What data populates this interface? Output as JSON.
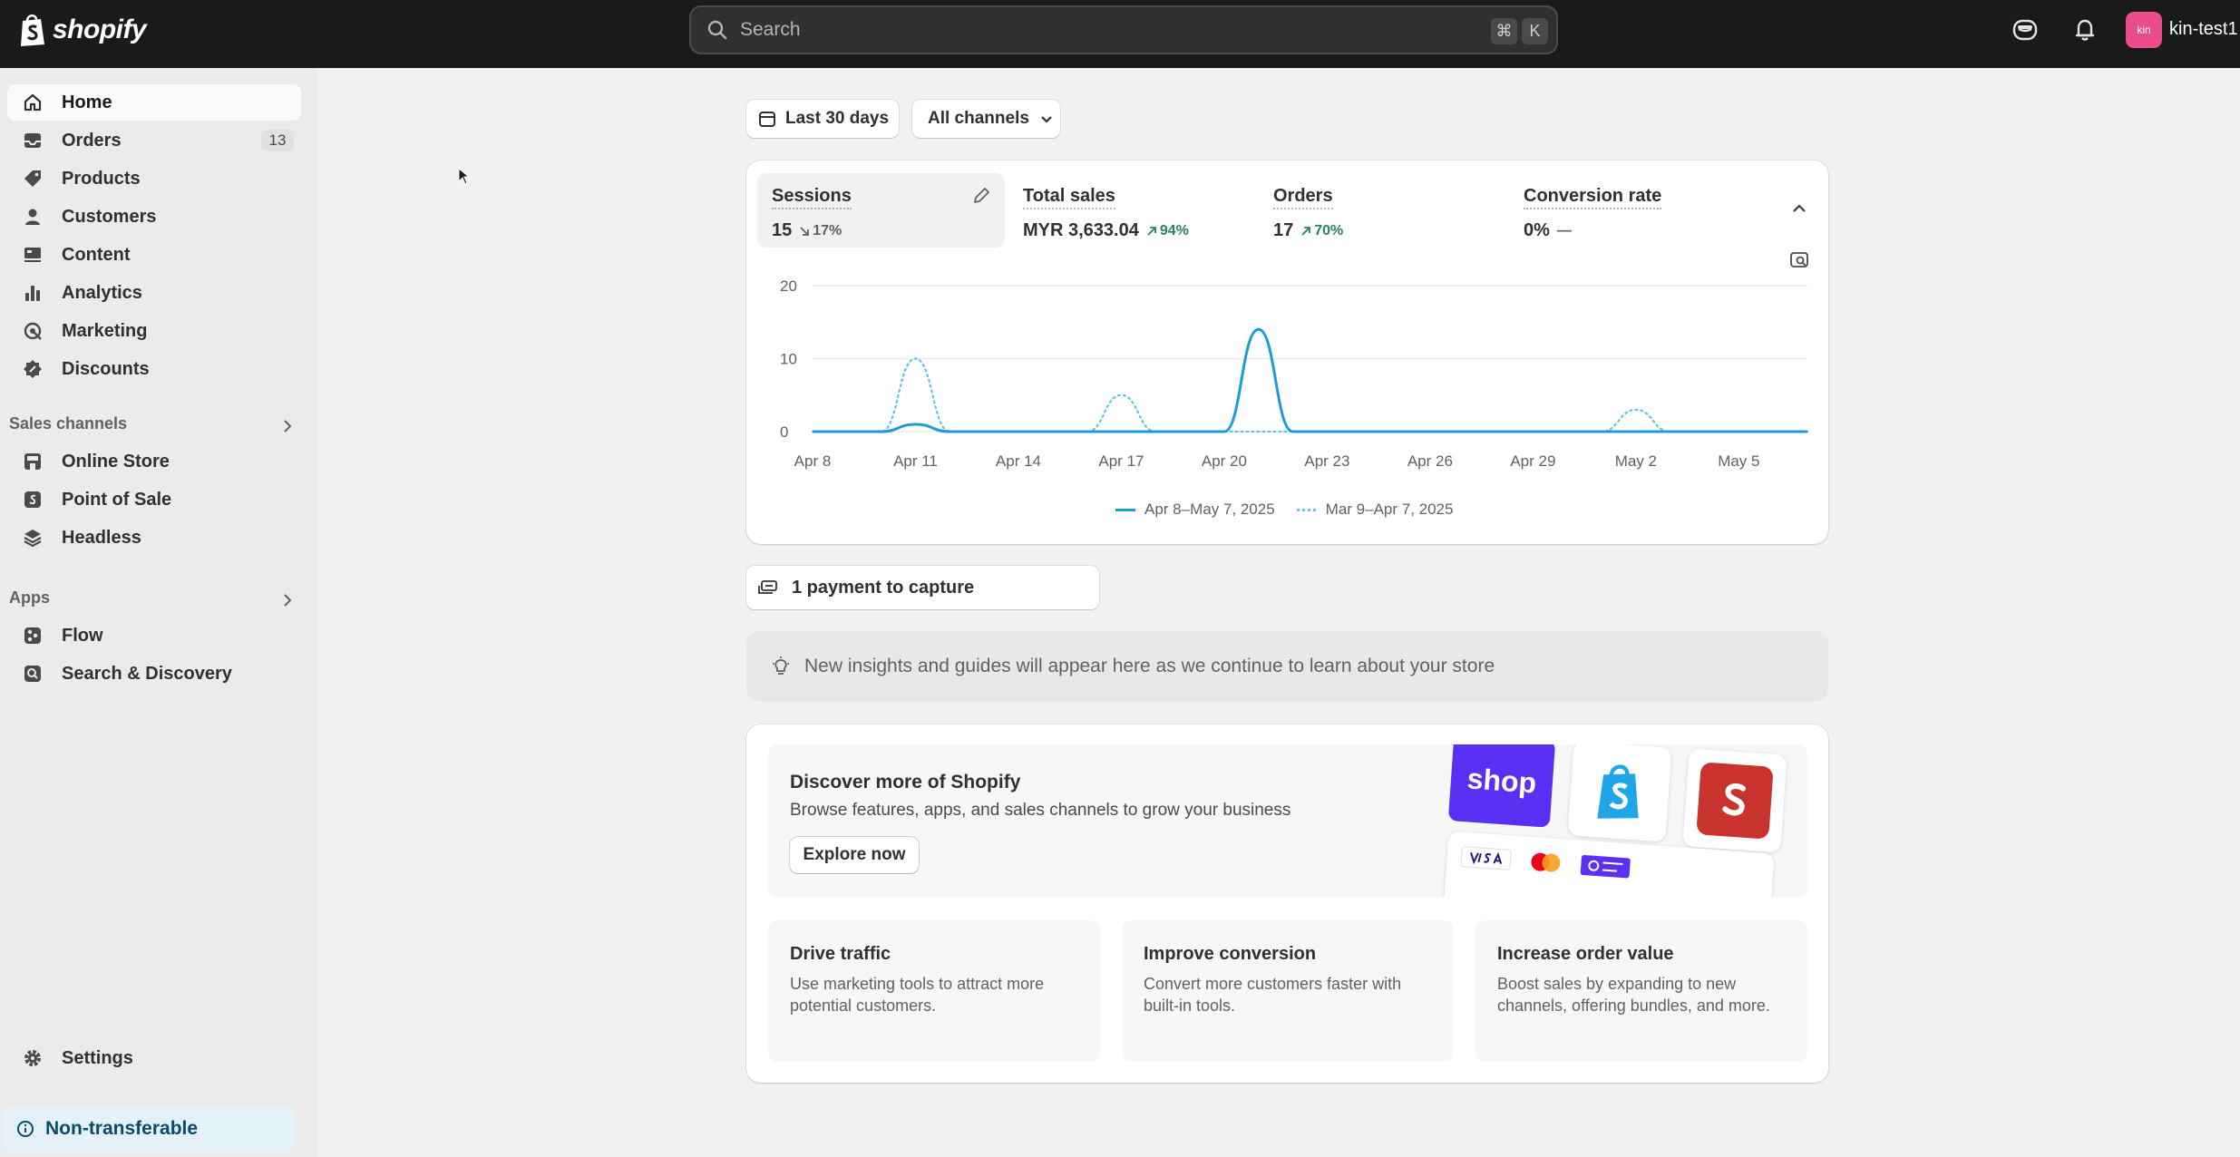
{
  "brand": {
    "logo_text": "shopify"
  },
  "search": {
    "placeholder": "Search",
    "shortcut_key1": "⌘",
    "shortcut_key2": "K"
  },
  "user": {
    "avatar_initials": "kin",
    "store_name": "kin-test1"
  },
  "sidebar": {
    "items": [
      {
        "label": "Home",
        "icon": "home-icon",
        "active": true
      },
      {
        "label": "Orders",
        "icon": "inbox-icon",
        "badge": "13"
      },
      {
        "label": "Products",
        "icon": "tag-icon"
      },
      {
        "label": "Customers",
        "icon": "person-icon"
      },
      {
        "label": "Content",
        "icon": "content-icon"
      },
      {
        "label": "Analytics",
        "icon": "bar-chart-icon"
      },
      {
        "label": "Marketing",
        "icon": "target-icon"
      },
      {
        "label": "Discounts",
        "icon": "discount-icon"
      }
    ],
    "sales_channels": {
      "title": "Sales channels",
      "items": [
        {
          "label": "Online Store",
          "icon": "store-icon"
        },
        {
          "label": "Point of Sale",
          "icon": "pos-icon"
        },
        {
          "label": "Headless",
          "icon": "headless-icon"
        }
      ]
    },
    "apps": {
      "title": "Apps",
      "items": [
        {
          "label": "Flow",
          "icon": "flow-icon"
        },
        {
          "label": "Search & Discovery",
          "icon": "search-discovery-icon"
        }
      ]
    },
    "settings_label": "Settings",
    "non_transferable_label": "Non-transferable"
  },
  "filters": {
    "date_range": "Last 30 days",
    "channels": "All channels"
  },
  "metrics": [
    {
      "title": "Sessions",
      "value": "15",
      "delta": "17%",
      "trend": "down"
    },
    {
      "title": "Total sales",
      "value": "MYR 3,633.04",
      "delta": "94%",
      "trend": "up"
    },
    {
      "title": "Orders",
      "value": "17",
      "delta": "70%",
      "trend": "up"
    },
    {
      "title": "Conversion rate",
      "value": "0%",
      "delta": "—",
      "trend": "flat"
    }
  ],
  "chart_data": {
    "type": "line",
    "x_tick_labels": [
      "Apr 8",
      "Apr 11",
      "Apr 14",
      "Apr 17",
      "Apr 20",
      "Apr 23",
      "Apr 26",
      "Apr 29",
      "May 2",
      "May 5"
    ],
    "y_tick_labels": [
      "0",
      "10",
      "20"
    ],
    "ylim": [
      0,
      20
    ],
    "x": [
      "Apr 8",
      "Apr 9",
      "Apr 10",
      "Apr 11",
      "Apr 12",
      "Apr 13",
      "Apr 14",
      "Apr 15",
      "Apr 16",
      "Apr 17",
      "Apr 18",
      "Apr 19",
      "Apr 20",
      "Apr 21",
      "Apr 22",
      "Apr 23",
      "Apr 24",
      "Apr 25",
      "Apr 26",
      "Apr 27",
      "Apr 28",
      "Apr 29",
      "Apr 30",
      "May 1",
      "May 2",
      "May 3",
      "May 4",
      "May 5",
      "May 6",
      "May 7"
    ],
    "series": [
      {
        "name": "Apr 8–May 7, 2025",
        "style": "solid",
        "color": "#1c9cd6",
        "values": [
          0,
          0,
          0,
          1,
          0,
          0,
          0,
          0,
          0,
          0,
          0,
          0,
          0,
          14,
          0,
          0,
          0,
          0,
          0,
          0,
          0,
          0,
          0,
          0,
          0,
          0,
          0,
          0,
          0,
          0
        ]
      },
      {
        "name": "Mar 9–Apr 7, 2025",
        "style": "dotted",
        "color": "#63c1ea",
        "values": [
          0,
          0,
          0,
          10,
          0,
          0,
          0,
          0,
          0,
          5,
          0,
          0,
          0,
          0,
          0,
          0,
          0,
          0,
          0,
          0,
          0,
          0,
          0,
          0,
          3,
          0,
          0,
          0,
          0,
          0
        ]
      }
    ],
    "grid": true,
    "legend_position": "bottom-center"
  },
  "payment": {
    "label": "1 payment to capture"
  },
  "insights": {
    "label": "New insights and guides will appear here as we continue to learn about your store"
  },
  "discover": {
    "title": "Discover more of Shopify",
    "subtitle": "Browse features, apps, and sales channels to grow your business",
    "button_label": "Explore now",
    "shop_logo_text": "shop"
  },
  "tiles": [
    {
      "title": "Drive traffic",
      "desc": "Use marketing tools to attract more potential customers."
    },
    {
      "title": "Improve conversion",
      "desc": "Convert more customers faster with built-in tools."
    },
    {
      "title": "Increase order value",
      "desc": "Boost sales by expanding to new channels, offering bundles, and more."
    }
  ],
  "colors": {
    "topbar": "#1a1a1a",
    "accent_line": "#1c9cd6",
    "positive": "#29845a",
    "avatar": "#ec4d8a"
  }
}
